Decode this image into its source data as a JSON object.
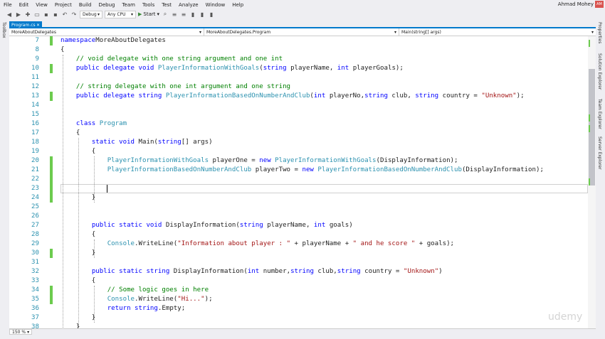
{
  "menu": [
    "File",
    "Edit",
    "View",
    "Project",
    "Build",
    "Debug",
    "Team",
    "Tools",
    "Test",
    "Analyze",
    "Window",
    "Help"
  ],
  "user": {
    "name": "Ahmad Mohey",
    "initials": "AM"
  },
  "toolbar": {
    "config": "Debug",
    "platform": "Any CPU",
    "start_label": "Start"
  },
  "left_tab": "Toolbox",
  "right_tabs": [
    "Properties",
    "Solution Explorer",
    "Team Explorer",
    "Server Explorer"
  ],
  "doc_tab": "Program.cs",
  "nav": {
    "project": "MoreAboutDelegates",
    "type": "MoreAboutDelegates.Program",
    "member": "Main(string[] args)"
  },
  "zoom": "150 %",
  "watermark": "udemy",
  "colors": {
    "accent": "#007acc",
    "keyword": "#0000ff",
    "type": "#2b91af",
    "comment": "#008000",
    "string": "#a31515",
    "changed": "#6ccb4e"
  },
  "lines": [
    {
      "n": "7",
      "changed": true,
      "tokens": [
        [
          "kw",
          "namespace"
        ],
        [
          "",
          "MoreAboutDelegates"
        ]
      ]
    },
    {
      "n": "8",
      "changed": false,
      "tokens": [
        [
          "",
          "{"
        ]
      ]
    },
    {
      "n": "9",
      "changed": false,
      "tokens": [
        [
          "",
          "    "
        ],
        [
          "cm",
          "// void delegate with one string argument and one int"
        ]
      ]
    },
    {
      "n": "10",
      "changed": true,
      "tokens": [
        [
          "",
          "    "
        ],
        [
          "kw",
          "public delegate void "
        ],
        [
          "ty",
          "PlayerInformationWithGoals"
        ],
        [
          "",
          "("
        ],
        [
          "kw",
          "string"
        ],
        [
          "",
          " playerName, "
        ],
        [
          "kw",
          "int"
        ],
        [
          "",
          " playerGoals);"
        ]
      ]
    },
    {
      "n": "11",
      "changed": false,
      "tokens": []
    },
    {
      "n": "12",
      "changed": false,
      "tokens": [
        [
          "",
          "    "
        ],
        [
          "cm",
          "// string delegate with one int argument and one string"
        ]
      ]
    },
    {
      "n": "13",
      "changed": true,
      "tokens": [
        [
          "",
          "    "
        ],
        [
          "kw",
          "public delegate string "
        ],
        [
          "ty",
          "PlayerInformationBasedOnNumberAndClub"
        ],
        [
          "",
          "("
        ],
        [
          "kw",
          "int"
        ],
        [
          "",
          " playerNo,"
        ],
        [
          "kw",
          "string"
        ],
        [
          "",
          " club, "
        ],
        [
          "kw",
          "string"
        ],
        [
          "",
          " country = "
        ],
        [
          "st",
          "\"Unknown\""
        ],
        [
          "",
          ");"
        ]
      ]
    },
    {
      "n": "14",
      "changed": false,
      "tokens": []
    },
    {
      "n": "15",
      "changed": false,
      "tokens": []
    },
    {
      "n": "16",
      "changed": false,
      "tokens": [
        [
          "",
          "    "
        ],
        [
          "kw",
          "class "
        ],
        [
          "ty",
          "Program"
        ]
      ]
    },
    {
      "n": "17",
      "changed": false,
      "tokens": [
        [
          "",
          "    {"
        ]
      ]
    },
    {
      "n": "18",
      "changed": false,
      "tokens": [
        [
          "",
          "        "
        ],
        [
          "kw",
          "static void "
        ],
        [
          "",
          "Main("
        ],
        [
          "kw",
          "string"
        ],
        [
          "",
          "[] args)"
        ]
      ]
    },
    {
      "n": "19",
      "changed": false,
      "tokens": [
        [
          "",
          "        {"
        ]
      ]
    },
    {
      "n": "20",
      "changed": true,
      "tokens": [
        [
          "",
          "            "
        ],
        [
          "ty",
          "PlayerInformationWithGoals"
        ],
        [
          "",
          " playerOne = "
        ],
        [
          "kw",
          "new "
        ],
        [
          "ty",
          "PlayerInformationWithGoals"
        ],
        [
          "",
          "(DisplayInformation);"
        ]
      ]
    },
    {
      "n": "21",
      "changed": true,
      "tokens": [
        [
          "",
          "            "
        ],
        [
          "ty",
          "PlayerInformationBasedOnNumberAndClub"
        ],
        [
          "",
          " playerTwo = "
        ],
        [
          "kw",
          "new "
        ],
        [
          "ty",
          "PlayerInformationBasedOnNumberAndClub"
        ],
        [
          "",
          "(DisplayInformation);"
        ]
      ]
    },
    {
      "n": "22",
      "changed": true,
      "tokens": []
    },
    {
      "n": "23",
      "changed": true,
      "tokens": []
    },
    {
      "n": "24",
      "changed": true,
      "tokens": [
        [
          "",
          "        }"
        ]
      ]
    },
    {
      "n": "25",
      "changed": false,
      "tokens": []
    },
    {
      "n": "26",
      "changed": false,
      "tokens": []
    },
    {
      "n": "27",
      "changed": false,
      "tokens": [
        [
          "",
          "        "
        ],
        [
          "kw",
          "public static void "
        ],
        [
          "",
          "DisplayInformation("
        ],
        [
          "kw",
          "string"
        ],
        [
          "",
          " playerName, "
        ],
        [
          "kw",
          "int"
        ],
        [
          "",
          " goals)"
        ]
      ]
    },
    {
      "n": "28",
      "changed": false,
      "tokens": [
        [
          "",
          "        {"
        ]
      ]
    },
    {
      "n": "29",
      "changed": false,
      "tokens": [
        [
          "",
          "            "
        ],
        [
          "ty",
          "Console"
        ],
        [
          "",
          ".WriteLine("
        ],
        [
          "st",
          "\"Information about player : \""
        ],
        [
          "",
          " + playerName + "
        ],
        [
          "st",
          "\" and he score \""
        ],
        [
          "",
          " + goals);"
        ]
      ]
    },
    {
      "n": "30",
      "changed": true,
      "tokens": [
        [
          "",
          "        }"
        ]
      ]
    },
    {
      "n": "31",
      "changed": false,
      "tokens": []
    },
    {
      "n": "32",
      "changed": false,
      "tokens": [
        [
          "",
          "        "
        ],
        [
          "kw",
          "public static string "
        ],
        [
          "",
          "DisplayInformation("
        ],
        [
          "kw",
          "int"
        ],
        [
          "",
          " number,"
        ],
        [
          "kw",
          "string"
        ],
        [
          "",
          " club,"
        ],
        [
          "kw",
          "string"
        ],
        [
          "",
          " country = "
        ],
        [
          "st",
          "\"Unknown\""
        ],
        [
          "",
          ")"
        ]
      ]
    },
    {
      "n": "33",
      "changed": false,
      "tokens": [
        [
          "",
          "        {"
        ]
      ]
    },
    {
      "n": "34",
      "changed": true,
      "tokens": [
        [
          "",
          "            "
        ],
        [
          "cm",
          "// Some logic goes in here"
        ]
      ]
    },
    {
      "n": "35",
      "changed": true,
      "tokens": [
        [
          "",
          "            "
        ],
        [
          "ty",
          "Console"
        ],
        [
          "",
          ".WriteLine("
        ],
        [
          "st",
          "\"Hi...\""
        ],
        [
          "",
          ");"
        ]
      ]
    },
    {
      "n": "36",
      "changed": false,
      "tokens": [
        [
          "",
          "            "
        ],
        [
          "kw",
          "return string"
        ],
        [
          "",
          ".Empty;"
        ]
      ]
    },
    {
      "n": "37",
      "changed": false,
      "tokens": [
        [
          "",
          "        }"
        ]
      ]
    },
    {
      "n": "38",
      "changed": false,
      "tokens": [
        [
          "",
          "    }"
        ]
      ]
    }
  ]
}
